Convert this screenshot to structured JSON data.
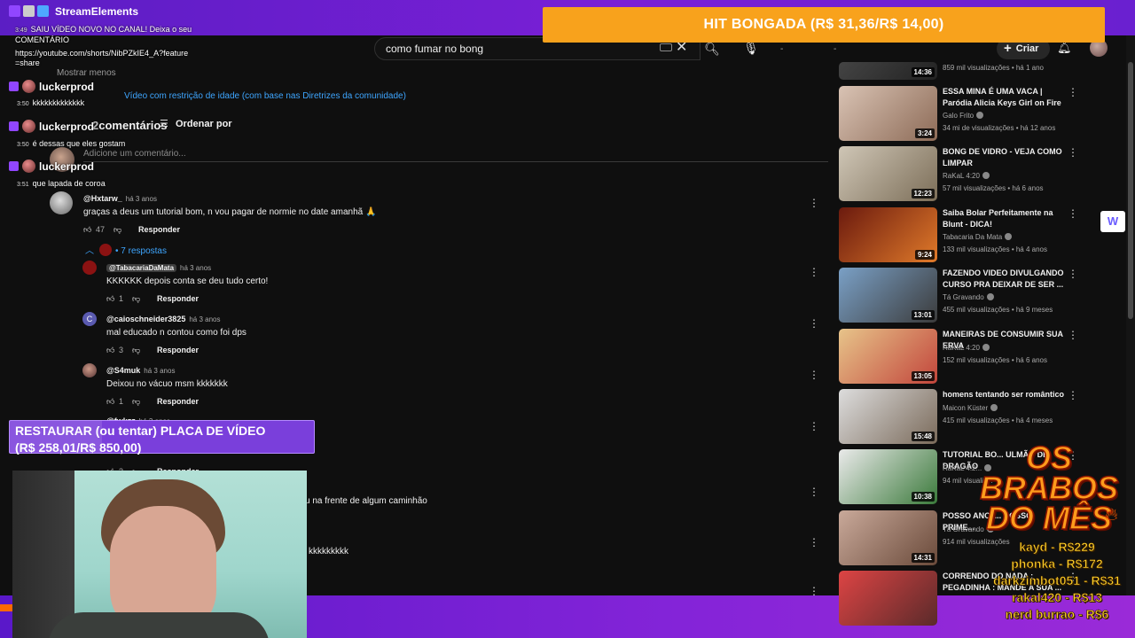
{
  "overlay": {
    "se_title": "StreamElements",
    "hit_goal": "HIT BONGADA (R$ 31,36/R$ 14,00)",
    "restore_goal_line1": "RESTAURAR (ou tentar) PLACA DE VÍDEO",
    "restore_goal_line2": "(R$ 258,01/R$ 850,00)",
    "restore_progress": 0.303,
    "brabos_title": "OS BRABOS DO MÊS",
    "brabos": [
      "kayd - R$229",
      "phonka - R$172",
      "darkzimbot051 - R$31",
      "rakal420 - R$13",
      "nerd burrao - R$6"
    ]
  },
  "chat": {
    "pinned_time": "3:49",
    "pinned_text": "SAIU VÍDEO NOVO NO CANAL! Deixa o seu COMENTÁRIO",
    "pinned_link": "https://youtube.com/shorts/NibPZkIE4_A?feature=share",
    "messages": [
      {
        "user": "luckerprod",
        "time": "3:50",
        "text": "kkkkkkkkkkkkk"
      },
      {
        "user": "luckerprod",
        "time": "3:50",
        "text": "é dessas que eles gostam"
      },
      {
        "user": "luckerprod",
        "time": "3:51",
        "text": "que lapada de coroa"
      }
    ]
  },
  "youtube": {
    "search_value": "como fumar no bong",
    "create_label": "Criar",
    "show_less": "Mostrar menos",
    "youtube_faint": "YouTube",
    "restriction": "Vídeo com restrição de idade (com base nas Diretrizes da comunidade)",
    "comments_title": "comentários",
    "sort_label": "Ordenar por",
    "add_comment_placeholder": "Adicione um comentário...",
    "comments": [
      {
        "author": "@Hxtarw_",
        "time": "há 3 anos",
        "text": "graças a deus um tutorial bom, n vou pagar de normie no date amanhã 🙏",
        "likes": "47",
        "reply": "Responder"
      }
    ],
    "replies_toggle": "7 respostas",
    "replies": [
      {
        "author": "@TabacariaDaMata",
        "time": "há 3 anos",
        "text": "KKKKKK depois conta se deu tudo certo!",
        "likes": "1",
        "reply": "Responder",
        "pinned": true
      },
      {
        "author": "@caioschneider3825",
        "time": "há 3 anos",
        "text": "mal educado n contou como foi dps",
        "likes": "3",
        "reply": "Responder",
        "initial": "C"
      },
      {
        "author": "@S4muk",
        "time": "há 3 anos",
        "text": "Deixou no vácuo msm kkkkkkk",
        "likes": "1",
        "reply": "Responder"
      },
      {
        "author": "@fwkzz",
        "time": "há 3 anos",
        "text": "",
        "likes": "3",
        "reply": "Responder"
      }
    ],
    "partial_text_1": "u na frente de algum caminhão",
    "partial_text_2": "kkkkkkkkk",
    "suggested": [
      {
        "title": "",
        "channel": "",
        "meta": "859 mil visualizações • há 1 ano",
        "duration": "14:36"
      },
      {
        "title": "ESSA MINA É UMA VACA | Paródia Alicia Keys Girl on Fire",
        "channel": "Galo Frito",
        "meta": "34 mi de visualizações • há 12 anos",
        "duration": "3:24"
      },
      {
        "title": "BONG DE VIDRO - VEJA COMO LIMPAR",
        "channel": "RaKaL 4:20",
        "meta": "57 mil visualizações • há 6 anos",
        "duration": "12:23"
      },
      {
        "title": "Saiba Bolar Perfeitamente na Blunt - DICA!",
        "channel": "Tabacaria Da Mata",
        "meta": "133 mil visualizações • há 4 anos",
        "duration": "9:24"
      },
      {
        "title": "FAZENDO VIDEO DIVULGANDO CURSO PRA DEIXAR DE SER ...",
        "channel": "Tá Gravando",
        "meta": "455 mil visualizações • há 9 meses",
        "duration": "13:01"
      },
      {
        "title": "MANEIRAS DE CONSUMIR SUA ERVA",
        "channel": "RaKaL 4:20",
        "meta": "152 mil visualizações • há 6 anos",
        "duration": "13:05"
      },
      {
        "title": "homens tentando ser romântico",
        "channel": "Maicon Küster",
        "meta": "415 mil visualizações • há 4 meses",
        "duration": "15:48"
      },
      {
        "title": "TUTORIAL BO... ULMÃO DE DRAGÃO",
        "channel": "RaKaL 4:2...",
        "meta": "94 mil visualiz...",
        "duration": "10:38"
      },
      {
        "title": "POSSO ANOT... NOSSO PRIME...",
        "channel": "Tá Gravando",
        "meta": "914 mil visualizações",
        "duration": "14:31"
      },
      {
        "title": "CORRENDO DO NADA : PEGADINHA : MANDE A SUA ...",
        "channel": "",
        "meta": "",
        "duration": ""
      }
    ]
  }
}
